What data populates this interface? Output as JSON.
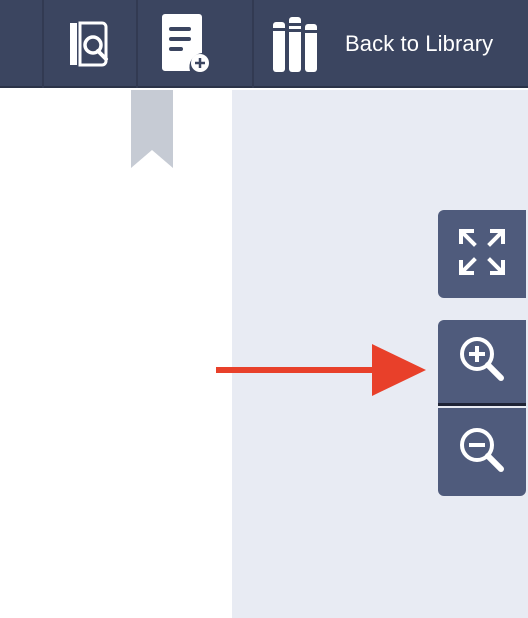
{
  "toolbar": {
    "back_label": "Back to Library",
    "background": "#3b4560",
    "buttons": [
      {
        "icon": "notebook-search-icon"
      },
      {
        "icon": "add-note-icon"
      },
      {
        "icon": "library-books-icon"
      }
    ]
  },
  "viewer": {
    "background": "#e8ebf3",
    "controls": [
      {
        "icon": "fullscreen-icon"
      },
      {
        "icon": "zoom-in-icon"
      },
      {
        "icon": "zoom-out-icon"
      }
    ],
    "control_color": "#4f5b7c"
  },
  "annotation": {
    "arrow_color": "#e8402a",
    "points_to": "zoom-in-button"
  }
}
